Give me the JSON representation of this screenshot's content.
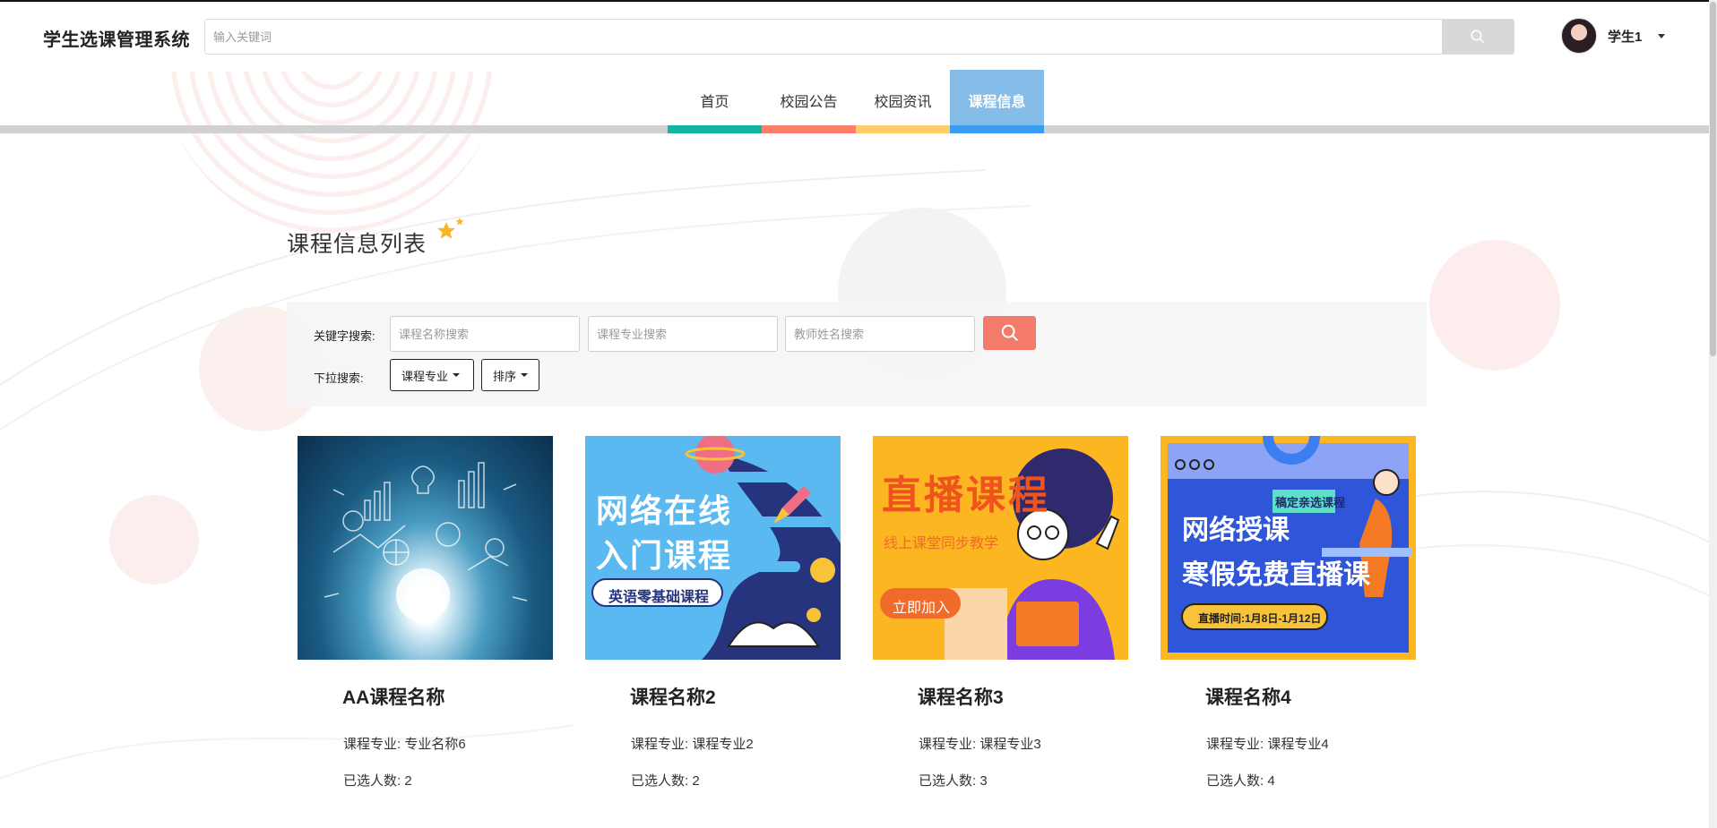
{
  "header": {
    "brand": "学生选课管理系统",
    "search_placeholder": "输入关键词",
    "user_name": "学生1"
  },
  "nav": {
    "items": [
      {
        "label": "首页",
        "color": "#12b4a4"
      },
      {
        "label": "校园公告",
        "color": "#fd7f6a"
      },
      {
        "label": "校园资讯",
        "color": "#ffce6b"
      },
      {
        "label": "课程信息",
        "color": "#3a9cf0",
        "active": true
      }
    ]
  },
  "section": {
    "title": "课程信息列表"
  },
  "filters": {
    "keyword_label": "关键字搜索:",
    "name_placeholder": "课程名称搜索",
    "major_placeholder": "课程专业搜索",
    "teacher_placeholder": "教师姓名搜索",
    "dropdown_label": "下拉搜索:",
    "major_dropdown": "课程专业",
    "sort_dropdown": "排序"
  },
  "courses": [
    {
      "name": "AA课程名称",
      "major_label": "课程专业: 专业名称6",
      "selected_label": "已选人数: 2",
      "image_text": []
    },
    {
      "name": "课程名称2",
      "major_label": "课程专业: 课程专业2",
      "selected_label": "已选人数: 2",
      "image_text": [
        "网络在线",
        "入门课程",
        "英语零基础课程"
      ]
    },
    {
      "name": "课程名称3",
      "major_label": "课程专业: 课程专业3",
      "selected_label": "已选人数: 3",
      "image_text": [
        "直播课程",
        "线上课堂同步教学",
        "立即加入"
      ]
    },
    {
      "name": "课程名称4",
      "major_label": "课程专业: 课程专业4",
      "selected_label": "已选人数: 4",
      "image_text": [
        "网络授课",
        "寒假免费直播课",
        "稿定亲选课程",
        "直播时间:1月8日-1月12日"
      ]
    }
  ],
  "colors": {
    "accent": "#f47a6a",
    "nav_active_bg": "#85bde8",
    "search_button": "#d8d8d8"
  }
}
